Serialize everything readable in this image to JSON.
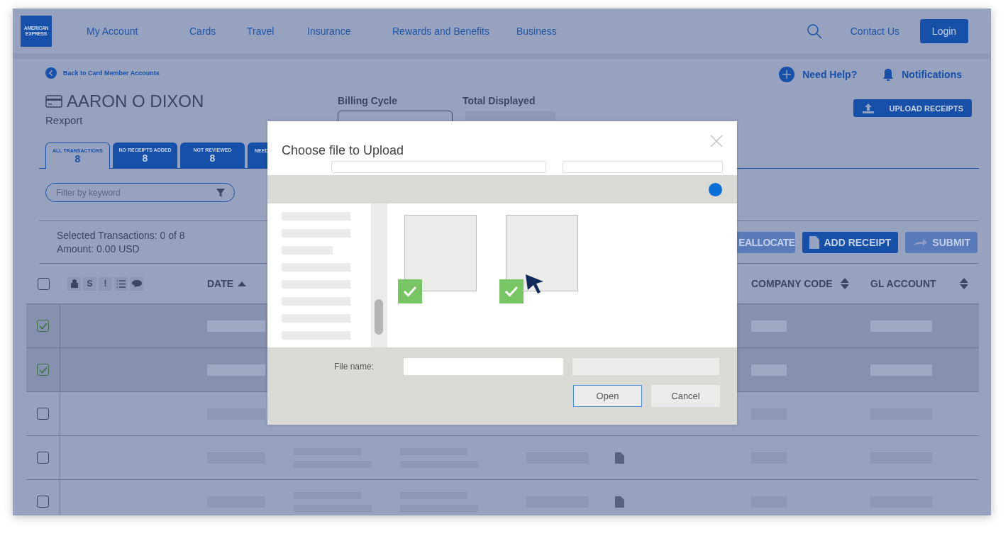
{
  "header": {
    "logo": [
      "AMERICAN",
      "EXPRESS"
    ],
    "nav": [
      "My Account",
      "Cards",
      "Travel",
      "Insurance",
      "Rewards and Benefits",
      "Business"
    ],
    "contact": "Contact Us",
    "login": "Login"
  },
  "back_link": "Back to Card Member Accounts",
  "card_member": {
    "name": "AARON O DIXON",
    "company": "Rexport"
  },
  "help": "Need Help?",
  "notifications": "Notifications",
  "upload_button": "UPLOAD RECEIPTS",
  "billing_cycle": {
    "label": "Billing Cycle"
  },
  "total_displayed": {
    "label": "Total Displayed"
  },
  "tabs": [
    {
      "label": "ALL TRANSACTIONS",
      "count": "8",
      "selected": true
    },
    {
      "label": "NO RECEIPTS ADDED",
      "count": "8",
      "selected": false
    },
    {
      "label": "NOT REVIEWED",
      "count": "8",
      "selected": false
    },
    {
      "label": "NEED",
      "selected": false
    }
  ],
  "filter": {
    "placeholder": "Filter by keyword"
  },
  "summary": [
    "Selected Transactions: 0 of 8",
    "Amount: 0.00 USD"
  ],
  "actions": [
    {
      "label": "EALLOCATE",
      "kind": "plain",
      "disabled": true
    },
    {
      "label": "ADD RECEIPT",
      "kind": "document",
      "disabled": false
    },
    {
      "label": "SUBMIT",
      "kind": "arrow",
      "disabled": true
    }
  ],
  "table": {
    "select_all": {
      "checked": false
    },
    "flag_icons": [
      {
        "kind": "lock"
      },
      {
        "kind": "text",
        "text": "S"
      },
      {
        "kind": "text",
        "text": "!"
      },
      {
        "kind": "list"
      },
      {
        "kind": "comment"
      }
    ],
    "columns": [
      {
        "label": "DATE",
        "sorted": true
      },
      {
        "label": "COMPANY CODE",
        "sorted": false
      },
      {
        "label": "GL ACCOUNT",
        "sorted": false
      }
    ],
    "rows": [
      {
        "checked": true
      },
      {
        "checked": true
      },
      {
        "checked": false
      },
      {
        "checked": false,
        "receipt": true
      },
      {
        "checked": false,
        "receipt": true
      }
    ]
  },
  "modal": {
    "title": "Choose file to Upload",
    "files": [
      {
        "checked": true
      },
      {
        "checked": true
      }
    ],
    "file_name_label": "File name:",
    "buttons": [
      {
        "label": "Open",
        "focused": true
      },
      {
        "label": "Cancel",
        "focused": false
      }
    ]
  }
}
